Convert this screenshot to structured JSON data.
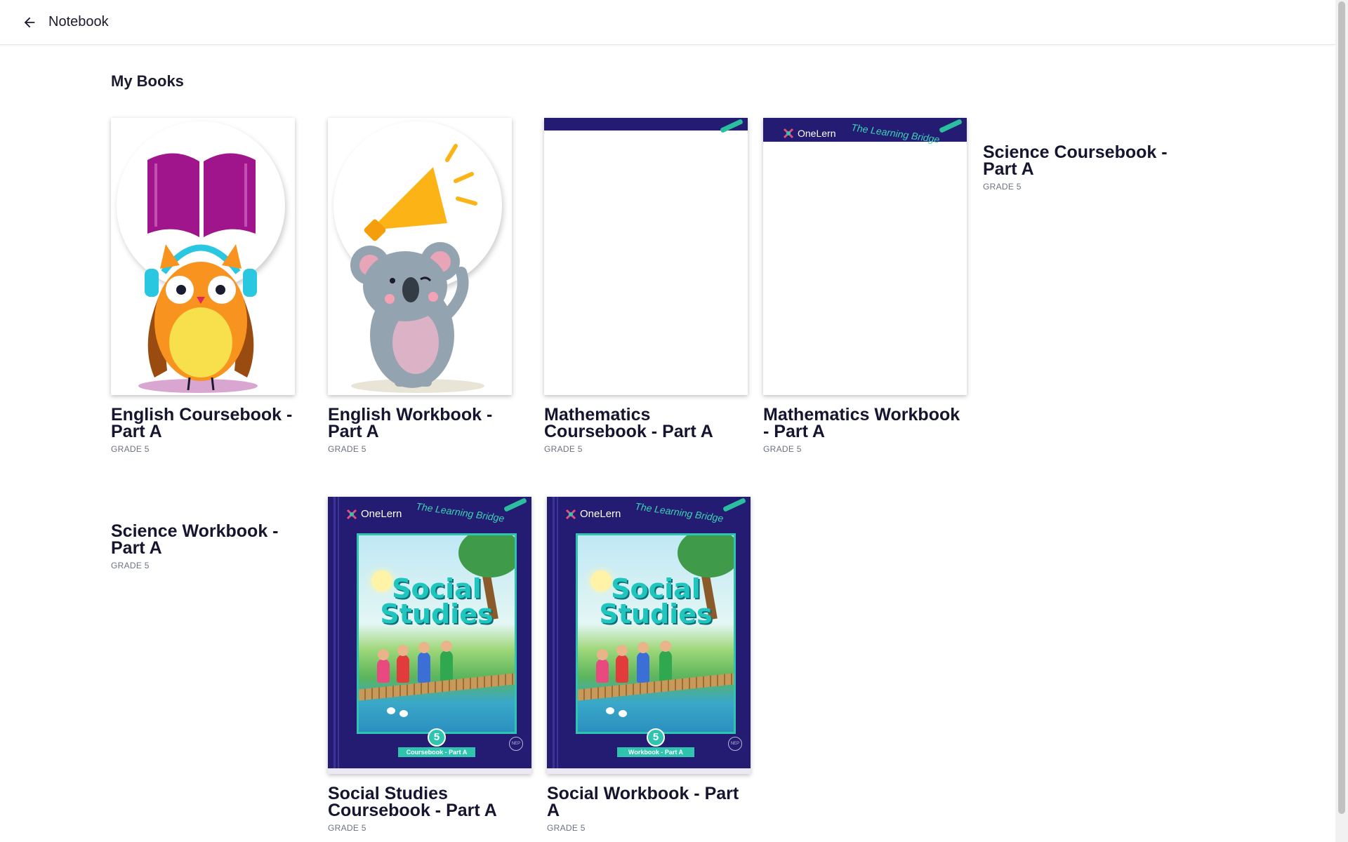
{
  "header": {
    "title": "Notebook",
    "back_icon": "arrow-left-icon"
  },
  "section": {
    "title": "My Books"
  },
  "books": [
    {
      "title": "English Coursebook - Part A",
      "grade": "GRADE 5"
    },
    {
      "title": "English Workbook - Part A",
      "grade": "GRADE 5"
    },
    {
      "title": "Mathematics Coursebook - Part A",
      "grade": "GRADE 5"
    },
    {
      "title": "Mathematics Workbook - Part A",
      "grade": "GRADE 5"
    },
    {
      "title": "Science Coursebook - Part A",
      "grade": "GRADE 5"
    },
    {
      "title": "Science Workbook - Part A",
      "grade": "GRADE 5"
    },
    {
      "title": "Social Studies Coursebook - Part A",
      "grade": "GRADE 5",
      "cover": {
        "brand": "OneLern",
        "tagline": "The Learning Bridge",
        "art_title_1": "Social",
        "art_title_2": "Studies",
        "grade_number": "5",
        "ribbon": "Coursebook - Part A",
        "stamp": "NEP"
      }
    },
    {
      "title": "Social Workbook - Part A",
      "grade": "GRADE 5",
      "cover": {
        "brand": "OneLern",
        "tagline": "The Learning Bridge",
        "art_title_1": "Social",
        "art_title_2": "Studies",
        "grade_number": "5",
        "ribbon": "Workbook - Part A",
        "stamp": "NEP"
      }
    }
  ],
  "partial_cover": {
    "brand": "OneLern",
    "tagline": "The Learning Bridge"
  },
  "colors": {
    "navy": "#241c72",
    "teal": "#2ec4b0",
    "magenta": "#a0148c",
    "owl_orange": "#f7931e",
    "megaphone": "#fbb315"
  }
}
